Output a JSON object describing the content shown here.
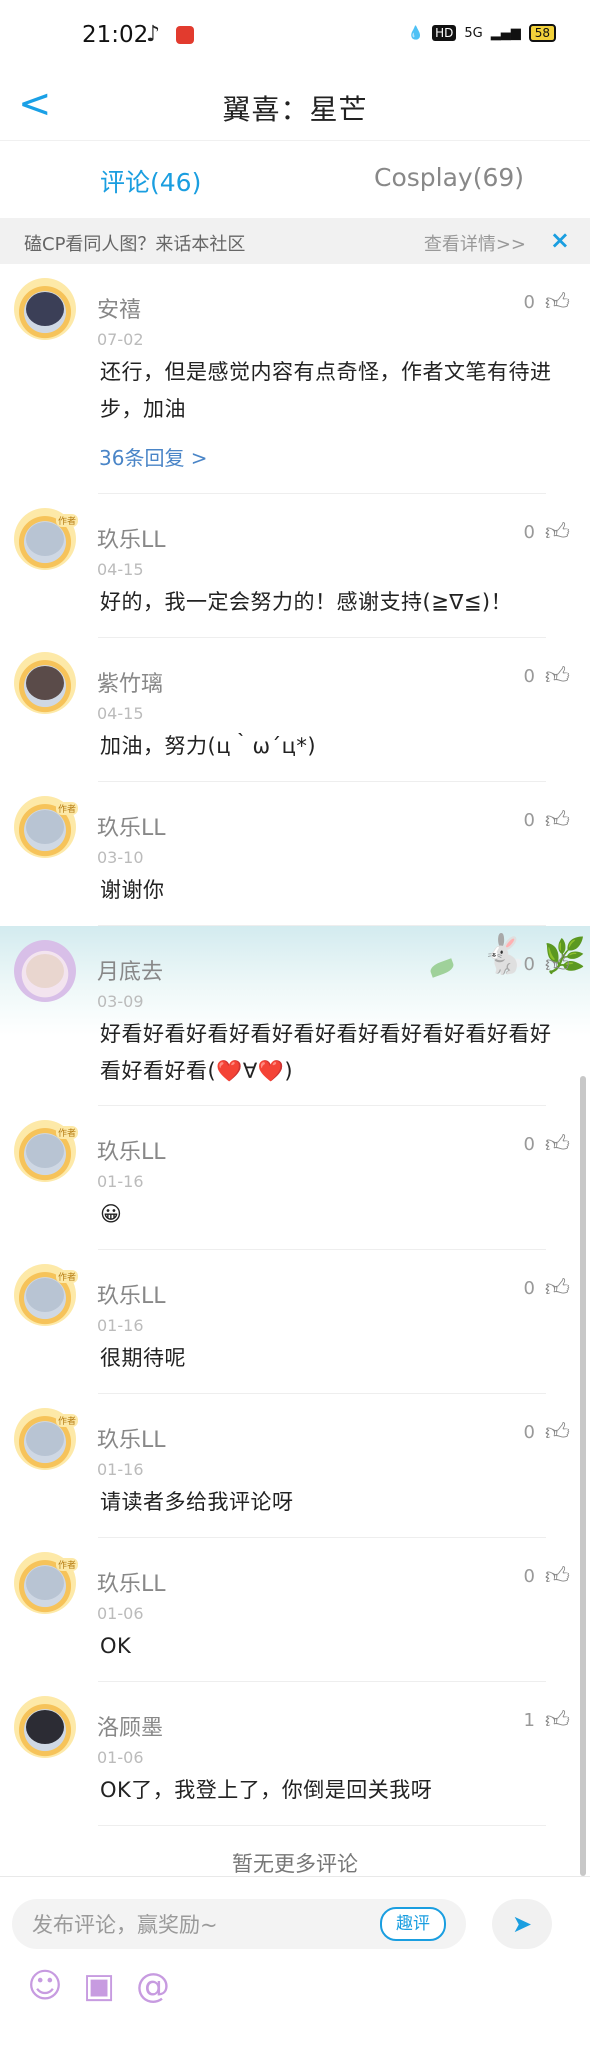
{
  "status": {
    "time": "21:02",
    "battery": "58",
    "network": "5G",
    "hd": "HD"
  },
  "header": {
    "back": "<",
    "title": "翼喜：星芒"
  },
  "tabs": [
    {
      "label": "评论(46)"
    },
    {
      "label": "Cosplay(69)"
    }
  ],
  "banner": {
    "text": "磕CP看同人图？来话本社区",
    "more": "查看详情>>",
    "close": "×"
  },
  "comments": [
    {
      "name": "安禧",
      "date": "07-02",
      "likes": "0",
      "text": "还行，但是感觉内容有点奇怪，作者文笔有待进步，加油",
      "replies": "36条回复 >"
    },
    {
      "name": "玖乐LL",
      "date": "04-15",
      "likes": "0",
      "text": "好的，我一定会努力的！感谢支持(≧∇≦)！"
    },
    {
      "name": "紫竹璃",
      "date": "04-15",
      "likes": "0",
      "text": "加油，努力(ц｀ω´ц*)"
    },
    {
      "name": "玖乐LL",
      "date": "03-10",
      "likes": "0",
      "text": "谢谢你"
    },
    {
      "name": "月底去",
      "date": "03-09",
      "likes": "0",
      "text": "好看好看好看好看好看好看好看好看好看好看好看好看好看(❤️∀❤️)"
    },
    {
      "name": "玖乐LL",
      "date": "01-16",
      "likes": "0",
      "text": "😀"
    },
    {
      "name": "玖乐LL",
      "date": "01-16",
      "likes": "0",
      "text": "很期待呢"
    },
    {
      "name": "玖乐LL",
      "date": "01-16",
      "likes": "0",
      "text": "请读者多给我评论呀"
    },
    {
      "name": "玖乐LL",
      "date": "01-06",
      "likes": "0",
      "text": "OK"
    },
    {
      "name": "洛顾墨",
      "date": "01-06",
      "likes": "1",
      "text": "OK了，我登上了，你倒是回关我呀"
    }
  ],
  "footer": {
    "no_more": "暂无更多评论"
  },
  "composer": {
    "placeholder": "发布评论，赢奖励~",
    "quick": "趣评",
    "send_icon": "send-icon",
    "tools": [
      "emoji-icon",
      "image-icon",
      "at-icon"
    ]
  },
  "badge_text": "作者",
  "colors": {
    "accent": "#1a9ee0",
    "link": "#4a85c7"
  }
}
